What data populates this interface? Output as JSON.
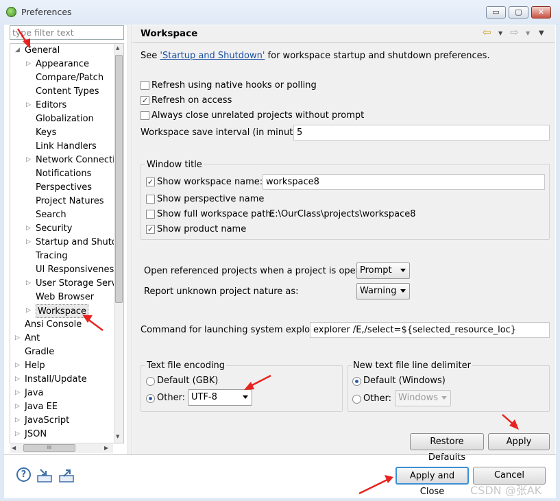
{
  "window": {
    "title": "Preferences",
    "min": "▭",
    "max": "▢",
    "close": "✕"
  },
  "sidebar": {
    "filter_placeholder": "type filter text",
    "items": [
      {
        "label": "General",
        "twisty": "◢",
        "level": 0
      },
      {
        "label": "Appearance",
        "twisty": "▷",
        "level": 1
      },
      {
        "label": "Compare/Patch",
        "twisty": "",
        "level": 1
      },
      {
        "label": "Content Types",
        "twisty": "",
        "level": 1
      },
      {
        "label": "Editors",
        "twisty": "▷",
        "level": 1
      },
      {
        "label": "Globalization",
        "twisty": "",
        "level": 1
      },
      {
        "label": "Keys",
        "twisty": "",
        "level": 1
      },
      {
        "label": "Link Handlers",
        "twisty": "",
        "level": 1
      },
      {
        "label": "Network Connectio",
        "twisty": "▷",
        "level": 1
      },
      {
        "label": "Notifications",
        "twisty": "",
        "level": 1
      },
      {
        "label": "Perspectives",
        "twisty": "",
        "level": 1
      },
      {
        "label": "Project Natures",
        "twisty": "",
        "level": 1
      },
      {
        "label": "Search",
        "twisty": "",
        "level": 1
      },
      {
        "label": "Security",
        "twisty": "▷",
        "level": 1
      },
      {
        "label": "Startup and Shutdo",
        "twisty": "▷",
        "level": 1
      },
      {
        "label": "Tracing",
        "twisty": "",
        "level": 1
      },
      {
        "label": "UI Responsiveness",
        "twisty": "",
        "level": 1
      },
      {
        "label": "User Storage Servic",
        "twisty": "▷",
        "level": 1
      },
      {
        "label": "Web Browser",
        "twisty": "",
        "level": 1
      },
      {
        "label": "Workspace",
        "twisty": "▷",
        "level": 1,
        "selected": true
      },
      {
        "label": "Ansi Console",
        "twisty": "",
        "level": 0
      },
      {
        "label": "Ant",
        "twisty": "▷",
        "level": 0
      },
      {
        "label": "Gradle",
        "twisty": "",
        "level": 0
      },
      {
        "label": "Help",
        "twisty": "▷",
        "level": 0
      },
      {
        "label": "Install/Update",
        "twisty": "▷",
        "level": 0
      },
      {
        "label": "Java",
        "twisty": "▷",
        "level": 0
      },
      {
        "label": "Java EE",
        "twisty": "▷",
        "level": 0
      },
      {
        "label": "JavaScript",
        "twisty": "▷",
        "level": 0
      },
      {
        "label": "JSON",
        "twisty": "▷",
        "level": 0
      }
    ],
    "hscroll_grip": "III"
  },
  "page": {
    "title": "Workspace",
    "nav": {
      "back": "⇦",
      "back_menu": "▼",
      "forward": "⇨",
      "forward_menu": "▼",
      "view_menu": "▼"
    },
    "intro_prefix": "See ",
    "intro_link": "'Startup and Shutdown'",
    "intro_suffix": " for workspace startup and shutdown preferences.",
    "refresh_native": {
      "label": "Refresh using native hooks or polling",
      "checked": false
    },
    "refresh_access": {
      "label": "Refresh on access",
      "checked": true
    },
    "always_close": {
      "label": "Always close unrelated projects without prompt",
      "checked": false
    },
    "save_interval_label": "Workspace save interval (in minutes):",
    "save_interval_value": "5",
    "window_title": {
      "group_label": "Window title",
      "show_ws_name": {
        "label": "Show workspace name:",
        "checked": true,
        "value": "workspace8"
      },
      "show_perspective": {
        "label": "Show perspective name",
        "checked": false
      },
      "show_full_path": {
        "label": "Show full workspace path:",
        "checked": false,
        "value": "E:\\OurClass\\projects\\workspace8"
      },
      "show_product": {
        "label": "Show product name",
        "checked": true
      }
    },
    "open_ref_label": "Open referenced projects when a project is opened:",
    "open_ref_value": "Prompt",
    "report_unknown_label": "Report unknown project nature as:",
    "report_unknown_value": "Warning",
    "cmd_label": "Command for launching system explorer:",
    "cmd_value": "explorer /E,/select=${selected_resource_loc}",
    "encoding": {
      "group_label": "Text file encoding",
      "default_label": "Default (GBK)",
      "other_label": "Other:",
      "other_value": "UTF-8",
      "selected": "other"
    },
    "delimiter": {
      "group_label": "New text file line delimiter",
      "default_label": "Default (Windows)",
      "other_label": "Other:",
      "other_value": "Windows",
      "selected": "default"
    },
    "restore_defaults": "Restore Defaults",
    "apply": "Apply"
  },
  "footer": {
    "help": "?",
    "apply_close": "Apply and Close",
    "cancel": "Cancel"
  },
  "watermark": "CSDN @张AK",
  "colors": {
    "arrow": "#e8231f",
    "link": "#1a4fa0",
    "accent": "#2b5ea6"
  }
}
